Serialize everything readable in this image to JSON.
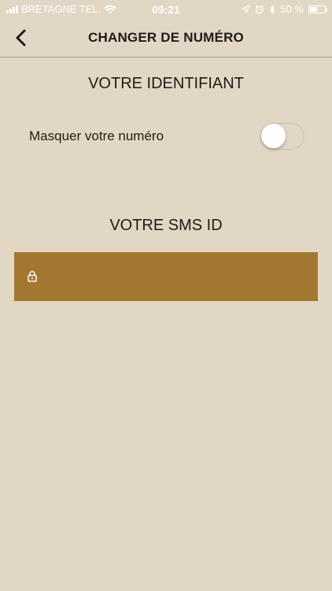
{
  "status_bar": {
    "carrier": "BRETAGNE TEL.",
    "time": "09:21",
    "battery_percent": "50 %",
    "battery_level": 0.5,
    "icons": [
      "signal-icon",
      "wifi-icon",
      "location-icon",
      "alarm-icon",
      "bluetooth-icon",
      "battery-icon"
    ]
  },
  "header": {
    "title": "CHANGER DE NUMÉRO",
    "back_icon": "chevron-left-icon"
  },
  "identifier_section": {
    "title": "VOTRE IDENTIFIANT",
    "hide_number_label": "Masquer votre numéro",
    "hide_number_enabled": false
  },
  "sms_section": {
    "title": "VOTRE SMS ID",
    "field_value": "",
    "field_icon": "lock-icon"
  },
  "colors": {
    "background": "#e2d7c4",
    "field_background": "#a2772f",
    "text": "#1f1b16"
  }
}
